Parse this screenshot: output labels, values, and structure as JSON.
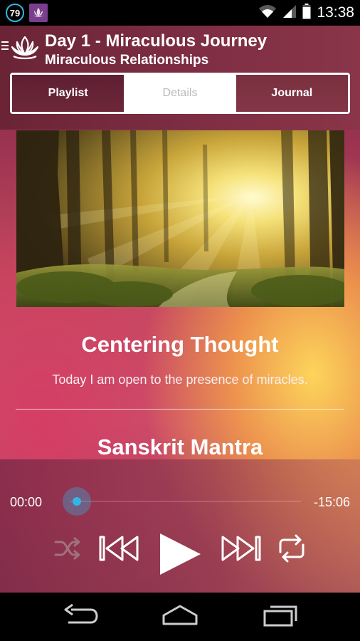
{
  "status_bar": {
    "notification_count": "79",
    "time": "13:38"
  },
  "header": {
    "title": "Day 1 - Miraculous Journey",
    "subtitle": "Miraculous Relationships"
  },
  "tabs": [
    {
      "label": "Playlist"
    },
    {
      "label": "Details",
      "selected": true
    },
    {
      "label": "Journal"
    }
  ],
  "content": {
    "centering_title": "Centering Thought",
    "centering_text": "Today I am open to the presence of miracles.",
    "mantra_title": "Sanskrit Mantra"
  },
  "player": {
    "elapsed": "00:00",
    "remaining": "-15:06",
    "progress": 0,
    "accent_color": "#33b5e5"
  },
  "icons": {
    "controls": [
      "shuffle-icon",
      "previous-icon",
      "play-icon",
      "next-icon",
      "repeat-icon"
    ],
    "nav": [
      "back-icon",
      "home-icon",
      "recent-apps-icon"
    ]
  }
}
